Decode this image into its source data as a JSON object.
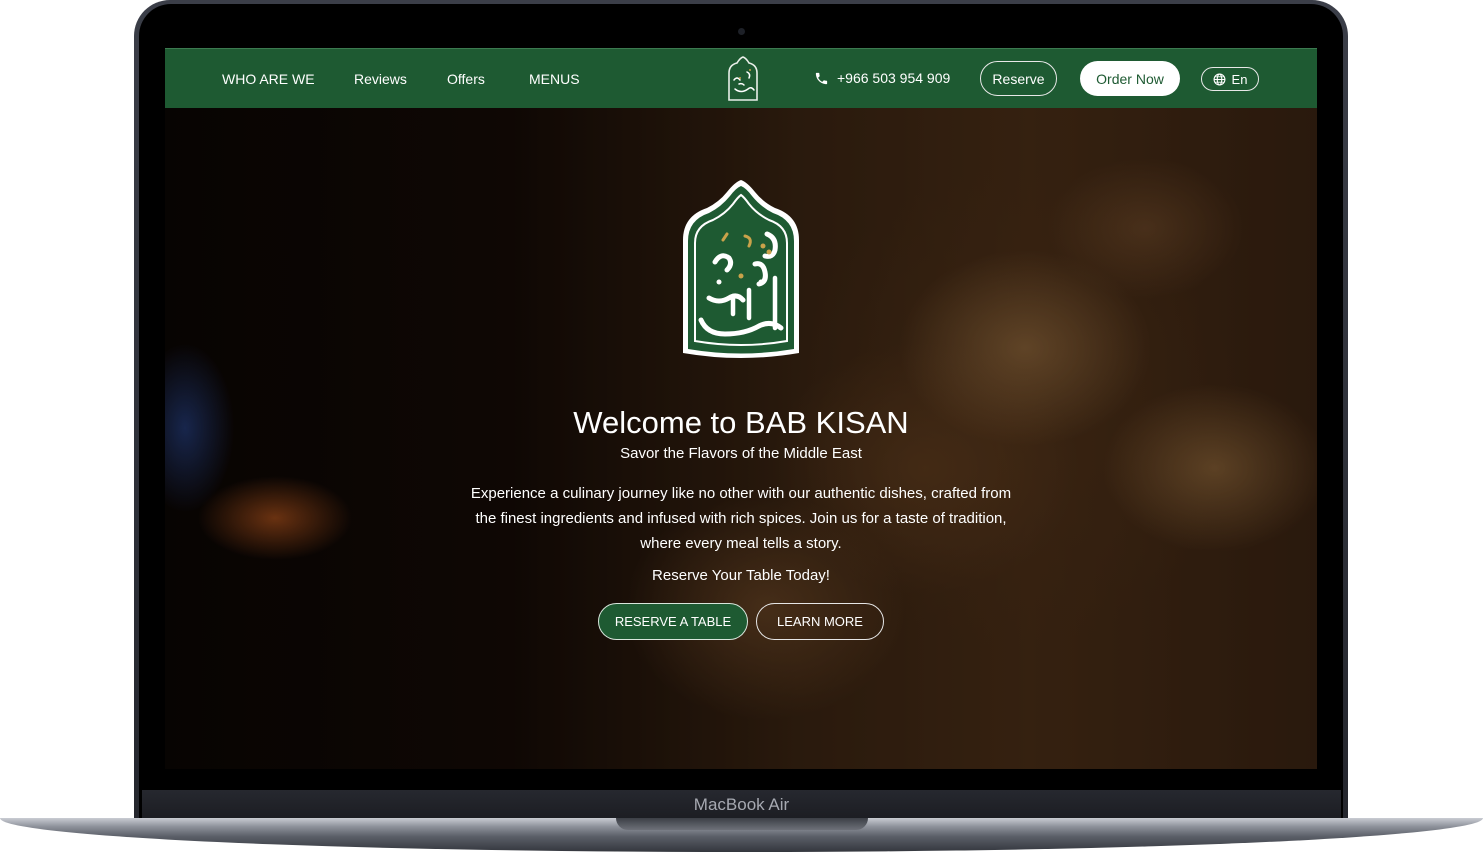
{
  "device": {
    "label": "MacBook Air"
  },
  "nav": {
    "links": [
      {
        "label": "WHO ARE WE"
      },
      {
        "label": "Reviews"
      },
      {
        "label": "Offers"
      },
      {
        "label": "MENUS"
      }
    ],
    "logo_icon": "bab-kisan-logo",
    "phone": {
      "icon": "phone-icon",
      "number": "+966 503 954 909"
    },
    "reserve_label": "Reserve",
    "order_label": "Order Now",
    "language": {
      "icon": "globe-icon",
      "label": "En"
    }
  },
  "hero": {
    "logo_icon": "bab-kisan-emblem",
    "title": "Welcome to BAB KISAN",
    "subtitle": "Savor the Flavors of the Middle East",
    "description": "Experience a culinary journey like no other with our authentic dishes, crafted from the finest ingredients and infused with rich spices. Join us for a taste of tradition, where every meal tells a story.",
    "cta_text": "Reserve Your Table Today!",
    "reserve_button": "RESERVE A TABLE",
    "learn_button": "LEARN MORE"
  },
  "colors": {
    "brand_green": "#1e5a32",
    "gold_accent": "#c9a24a",
    "white": "#ffffff"
  }
}
